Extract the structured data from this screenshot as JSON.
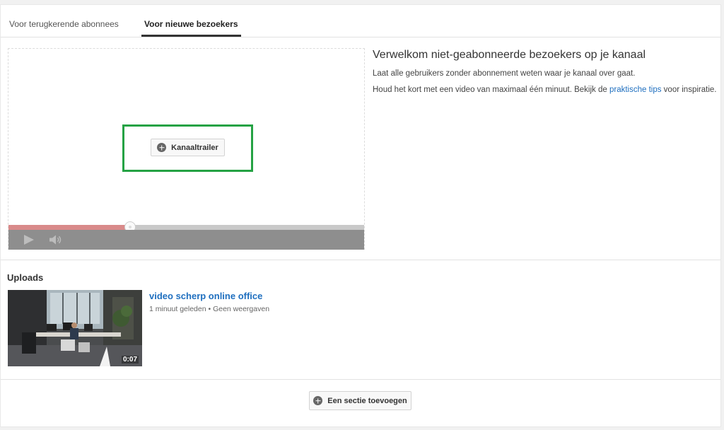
{
  "tabs": [
    {
      "label": "Voor terugkerende abonnees",
      "active": false
    },
    {
      "label": "Voor nieuwe bezoekers",
      "active": true
    }
  ],
  "player": {
    "trailer_button_label": "Kanaaltrailer",
    "progress_fraction": 0.34
  },
  "welcome": {
    "title": "Verwelkom niet-geabonneerde bezoekers op je kanaal",
    "line1": "Laat alle gebruikers zonder abonnement weten waar je kanaal over gaat.",
    "line2_before": "Houd het kort met een video van maximaal één minuut. Bekijk de ",
    "line2_link": "praktische tips",
    "line2_after": " voor inspiratie."
  },
  "uploads": {
    "title": "Uploads",
    "video": {
      "title": "video scherp online office",
      "meta": "1 minuut geleden • Geen weergaven",
      "duration": "0:07"
    }
  },
  "add_section_label": "Een sectie toevoegen",
  "colors": {
    "highlight": "#25a244",
    "link": "#1f6fbf",
    "progress": "#d98a8a"
  }
}
